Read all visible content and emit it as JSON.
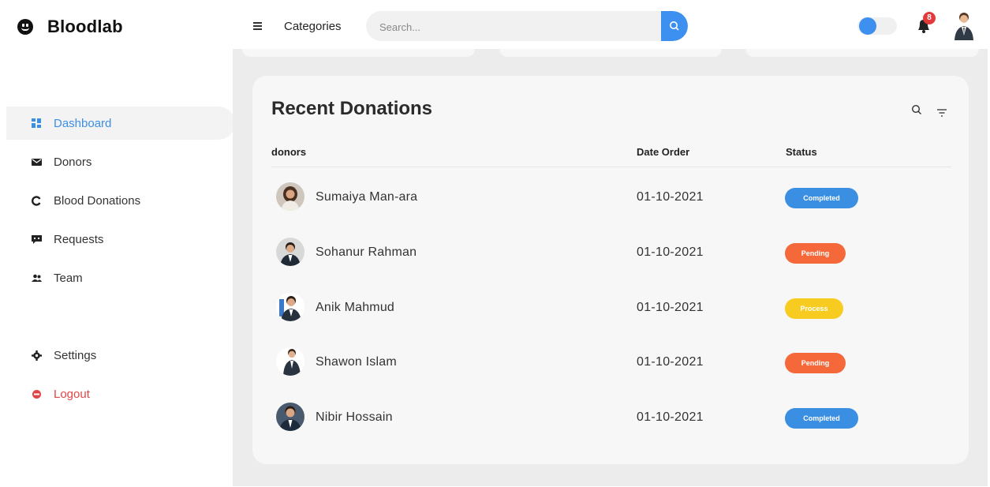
{
  "app": {
    "brand_name": "Bloodlab"
  },
  "sidebar": {
    "items": [
      {
        "label": "Dashboard",
        "icon": "dashboard-grid-icon"
      },
      {
        "label": "Donors",
        "icon": "envelope-icon"
      },
      {
        "label": "Blood Donations",
        "icon": "circle-refresh-icon"
      },
      {
        "label": "Requests",
        "icon": "chat-bubble-icon"
      },
      {
        "label": "Team",
        "icon": "team-users-icon"
      },
      {
        "label": "Settings",
        "icon": "gear-icon"
      },
      {
        "label": "Logout",
        "icon": "logout-icon"
      }
    ]
  },
  "header": {
    "categories_label": "Categories",
    "search_placeholder": "Search...",
    "notification_count": "8"
  },
  "donations": {
    "title": "Recent Donations",
    "columns": [
      "donors",
      "Date Order",
      "Status"
    ],
    "rows": [
      {
        "name": "Sumaiya Man-ara",
        "date": "01-10-2021",
        "status": "Completed"
      },
      {
        "name": "Sohanur Rahman",
        "date": "01-10-2021",
        "status": "Pending"
      },
      {
        "name": "Anik Mahmud",
        "date": "01-10-2021",
        "status": "Process"
      },
      {
        "name": "Shawon Islam",
        "date": "01-10-2021",
        "status": "Pending"
      },
      {
        "name": "Nibir Hossain",
        "date": "01-10-2021",
        "status": "Completed"
      }
    ]
  },
  "colors": {
    "accent": "#3d8ff0",
    "completed": "#3b8fe3",
    "pending": "#f4683a",
    "process": "#f7cb1f",
    "logout": "#e04646"
  }
}
